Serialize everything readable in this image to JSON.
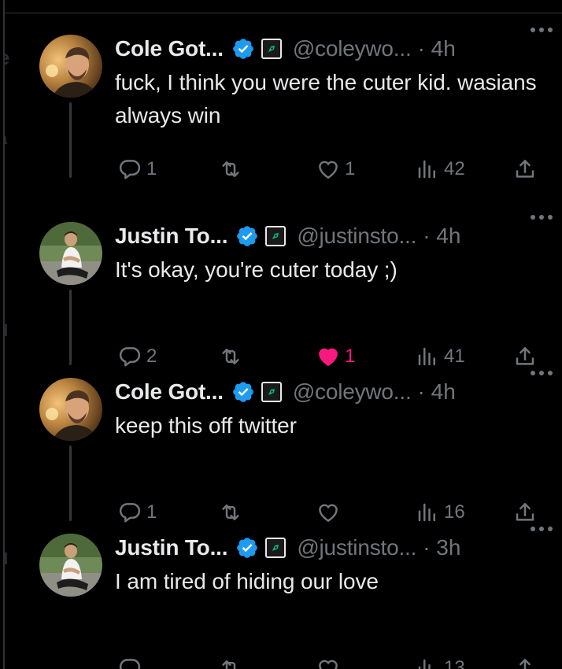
{
  "tweets": [
    {
      "name": "Cole Got...",
      "handle": "@coleywo...",
      "time": "· 4h",
      "text": "fuck, I think you were the cuter kid. wasians always win",
      "replies": "1",
      "retweets": "",
      "likes": "1",
      "liked": false,
      "views": "42",
      "avatar": "cole",
      "thread_line": true
    },
    {
      "name": "Justin To...",
      "handle": "@justinsto...",
      "time": "· 4h",
      "text": "It's okay, you're cuter today ;)",
      "replies": "2",
      "retweets": "",
      "likes": "1",
      "liked": true,
      "views": "41",
      "avatar": "justin",
      "thread_line": true
    },
    {
      "name": "Cole Got...",
      "handle": "@coleywo...",
      "time": "· 4h",
      "text": "keep this off twitter",
      "replies": "1",
      "retweets": "",
      "likes": "",
      "liked": false,
      "views": "16",
      "avatar": "cole",
      "thread_line": true
    },
    {
      "name": "Justin To...",
      "handle": "@justinsto...",
      "time": "· 3h",
      "text": "I am tired of hiding our love",
      "replies": "",
      "retweets": "",
      "likes": "",
      "liked": false,
      "views": "13",
      "avatar": "justin",
      "thread_line": false
    }
  ],
  "icons": {
    "verified": "verified-badge-icon",
    "affiliation": "affiliate-badge-icon",
    "more": "more-dots-icon",
    "reply": "reply-icon",
    "retweet": "retweet-icon",
    "like": "heart-icon",
    "views": "views-bar-chart-icon",
    "share": "share-icon"
  },
  "colors": {
    "background": "#000000",
    "text": "#e7e9ea",
    "secondary": "#71767b",
    "verified": "#1d9bf0",
    "like_active": "#f91880",
    "divider": "#2f3336"
  }
}
